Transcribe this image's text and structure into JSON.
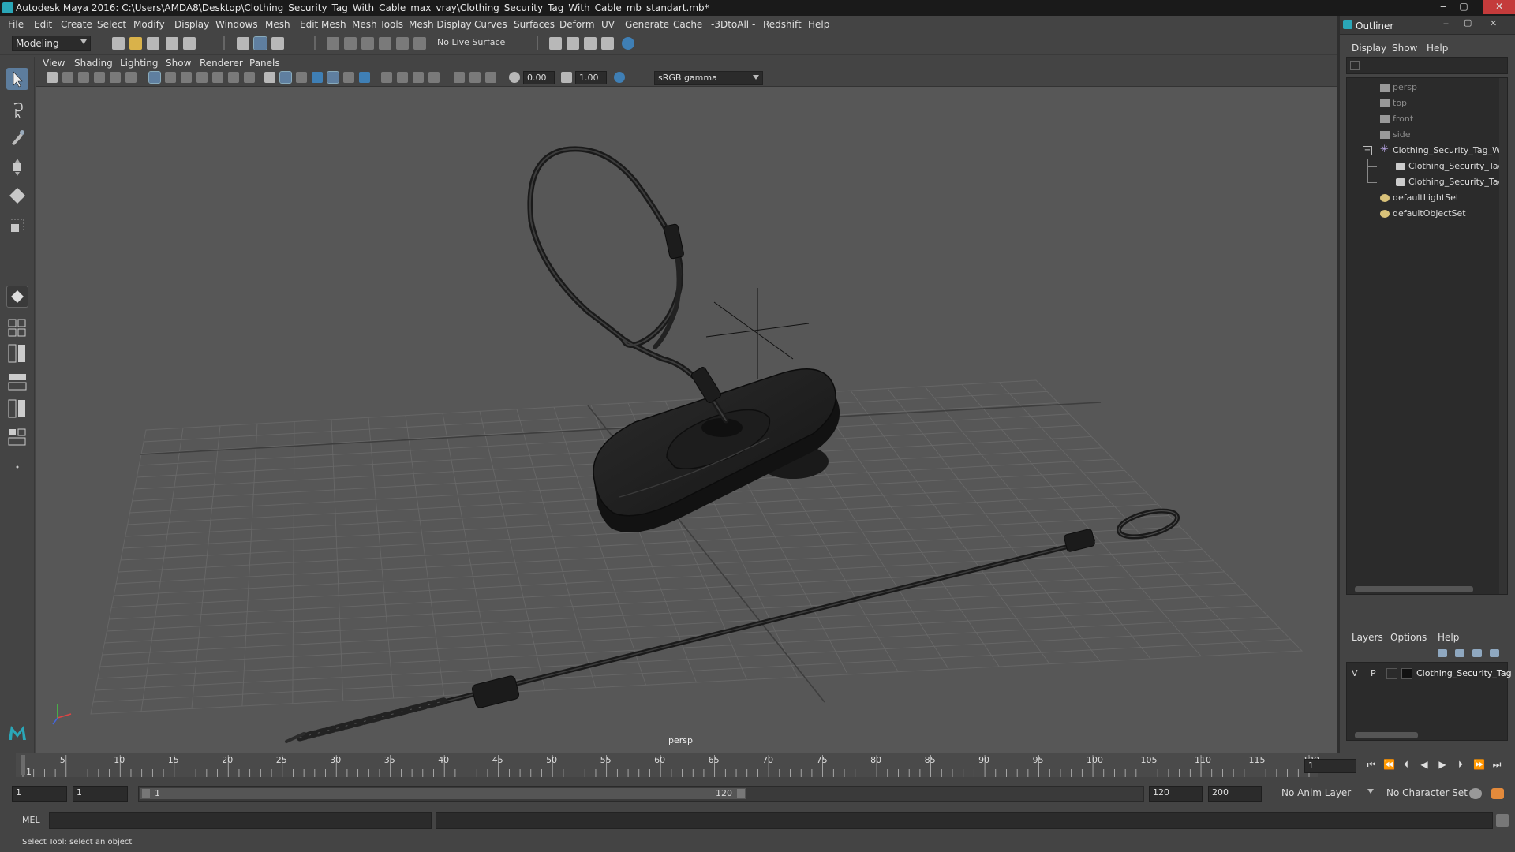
{
  "window": {
    "title": "Autodesk Maya 2016: C:\\Users\\AMDA8\\Desktop\\Clothing_Security_Tag_With_Cable_max_vray\\Clothing_Security_Tag_With_Cable_mb_standart.mb*",
    "minimize": "‒",
    "maximize": "▢",
    "close": "✕"
  },
  "menubar": {
    "items": [
      "File",
      "Edit",
      "Create",
      "Select",
      "Modify",
      "Display",
      "Windows",
      "Mesh",
      "Edit Mesh",
      "Mesh Tools",
      "Mesh Display",
      "Curves",
      "Surfaces",
      "Deform",
      "UV",
      "Generate",
      "Cache",
      "-3DtoAll -",
      "Redshift",
      "Help"
    ]
  },
  "shelf": {
    "mode": "Modeling",
    "live_surface": "No Live Surface"
  },
  "viewport": {
    "menu": [
      "View",
      "Shading",
      "Lighting",
      "Show",
      "Renderer",
      "Panels"
    ],
    "exposure": "0.00",
    "gamma": "1.00",
    "color_space": "sRGB gamma",
    "camera_label": "persp"
  },
  "outliner": {
    "title": "Outliner",
    "menu": [
      "Display",
      "Show",
      "Help"
    ],
    "items": [
      {
        "label": "persp",
        "dim": true
      },
      {
        "label": "top",
        "dim": true
      },
      {
        "label": "front",
        "dim": true
      },
      {
        "label": "side",
        "dim": true
      },
      {
        "label": "Clothing_Security_Tag_Wi",
        "dim": false
      },
      {
        "label": "Clothing_Security_Tag",
        "dim": false
      },
      {
        "label": "Clothing_Security_Tag",
        "dim": false
      },
      {
        "label": "defaultLightSet",
        "dim": false
      },
      {
        "label": "defaultObjectSet",
        "dim": false
      }
    ]
  },
  "layers": {
    "menu": [
      "Layers",
      "Options",
      "Help"
    ],
    "row": {
      "v": "V",
      "p": "P",
      "name": "Clothing_Security_Tag"
    }
  },
  "timeline": {
    "ticks": [
      "1",
      "5",
      "10",
      "15",
      "20",
      "25",
      "30",
      "35",
      "40",
      "45",
      "50",
      "55",
      "60",
      "65",
      "70",
      "75",
      "80",
      "85",
      "90",
      "95",
      "100",
      "105",
      "110",
      "115",
      "120"
    ],
    "current_frame": "1"
  },
  "range": {
    "start": "1",
    "anim_start": "1",
    "slider_start": "1",
    "slider_end": "120",
    "end": "120",
    "anim_end": "200",
    "anim_layer": "No Anim Layer",
    "character_set": "No Character Set"
  },
  "command": {
    "label": "MEL"
  },
  "status": {
    "help_line": "Select Tool: select an object"
  }
}
